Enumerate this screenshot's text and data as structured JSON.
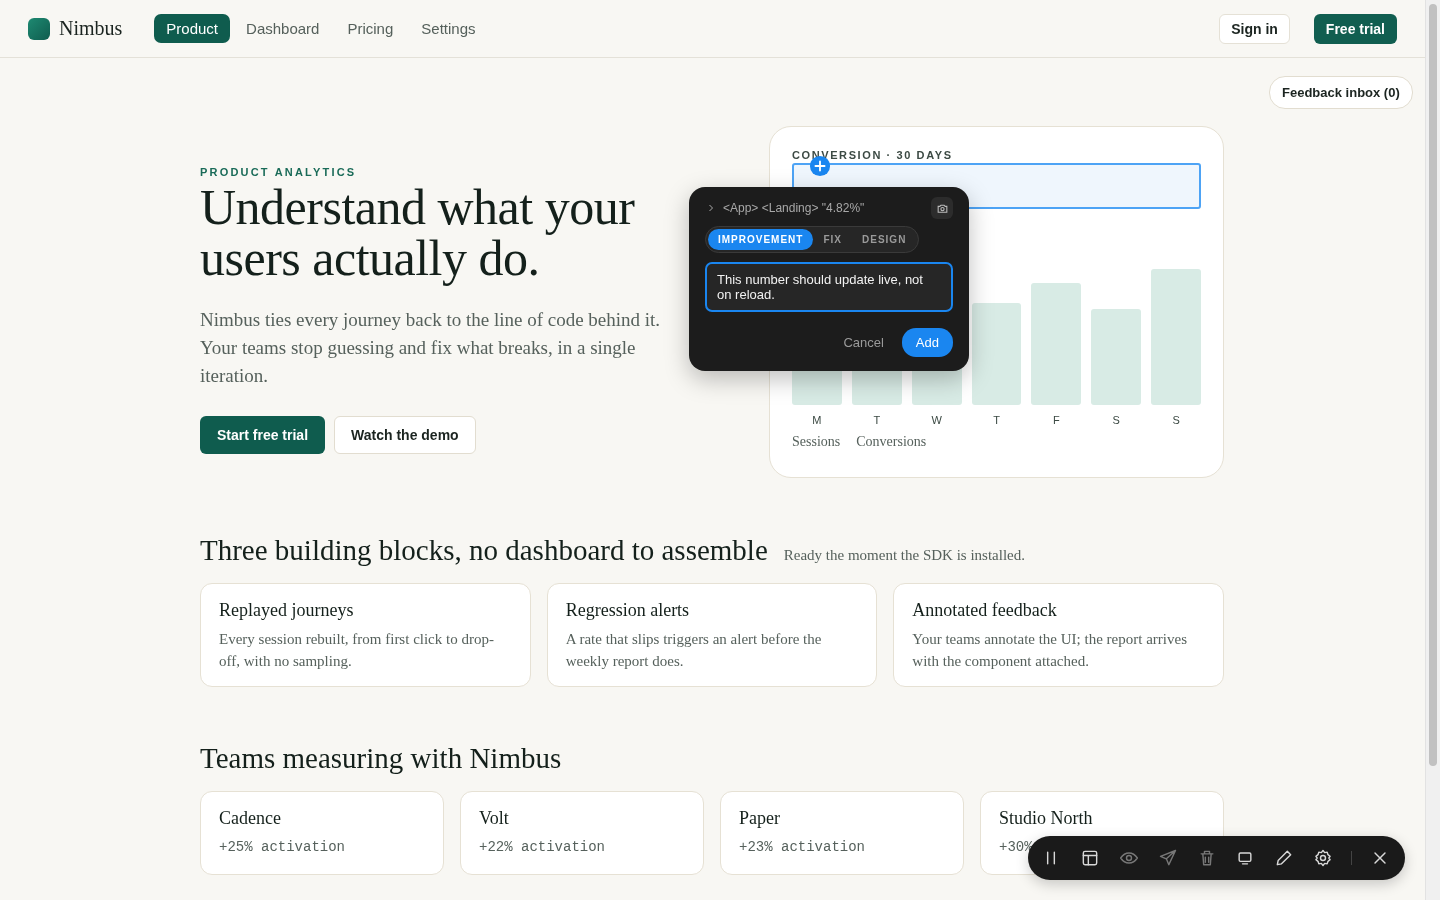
{
  "header": {
    "brand": "Nimbus",
    "nav": [
      {
        "label": "Product",
        "selected": true
      },
      {
        "label": "Dashboard",
        "selected": false
      },
      {
        "label": "Pricing",
        "selected": false
      },
      {
        "label": "Settings",
        "selected": false
      }
    ],
    "sign_in": "Sign in",
    "free_trial": "Free trial"
  },
  "feedback_inbox": "Feedback inbox (0)",
  "hero": {
    "eyebrow": "PRODUCT ANALYTICS",
    "title": "Understand what your users actually do.",
    "lead": "Nimbus ties every journey back to the line of code behind it. Your teams stop guessing and fix what breaks, in a single iteration.",
    "primary": "Start free trial",
    "secondary": "Watch the demo"
  },
  "metric_card": {
    "label": "CONVERSION · 30 DAYS",
    "days": [
      "M",
      "T",
      "W",
      "T",
      "F",
      "S",
      "S"
    ],
    "legend": [
      "Sessions",
      "Conversions"
    ]
  },
  "annotation": {
    "path": "<App> <Landing> \"4.82%\"",
    "types": [
      {
        "label": "IMPROVEMENT",
        "selected": true
      },
      {
        "label": "FIX",
        "selected": false
      },
      {
        "label": "DESIGN",
        "selected": false
      }
    ],
    "comment": "This number should update live, not on reload.",
    "cancel": "Cancel",
    "add": "Add"
  },
  "features": {
    "title": "Three building blocks, no dashboard to assemble",
    "subtitle": "Ready the moment the SDK is installed.",
    "cards": [
      {
        "title": "Replayed journeys",
        "text": "Every session rebuilt, from first click to drop-off, with no sampling."
      },
      {
        "title": "Regression alerts",
        "text": "A rate that slips triggers an alert before the weekly report does."
      },
      {
        "title": "Annotated feedback",
        "text": "Your teams annotate the UI; the report arrives with the component attached."
      }
    ]
  },
  "teams": {
    "title": "Teams measuring with Nimbus",
    "cards": [
      {
        "name": "Cadence",
        "stat": "+25% activation"
      },
      {
        "name": "Volt",
        "stat": "+22% activation"
      },
      {
        "name": "Paper",
        "stat": "+23% activation"
      },
      {
        "name": "Studio North",
        "stat": "+30%"
      }
    ]
  }
}
